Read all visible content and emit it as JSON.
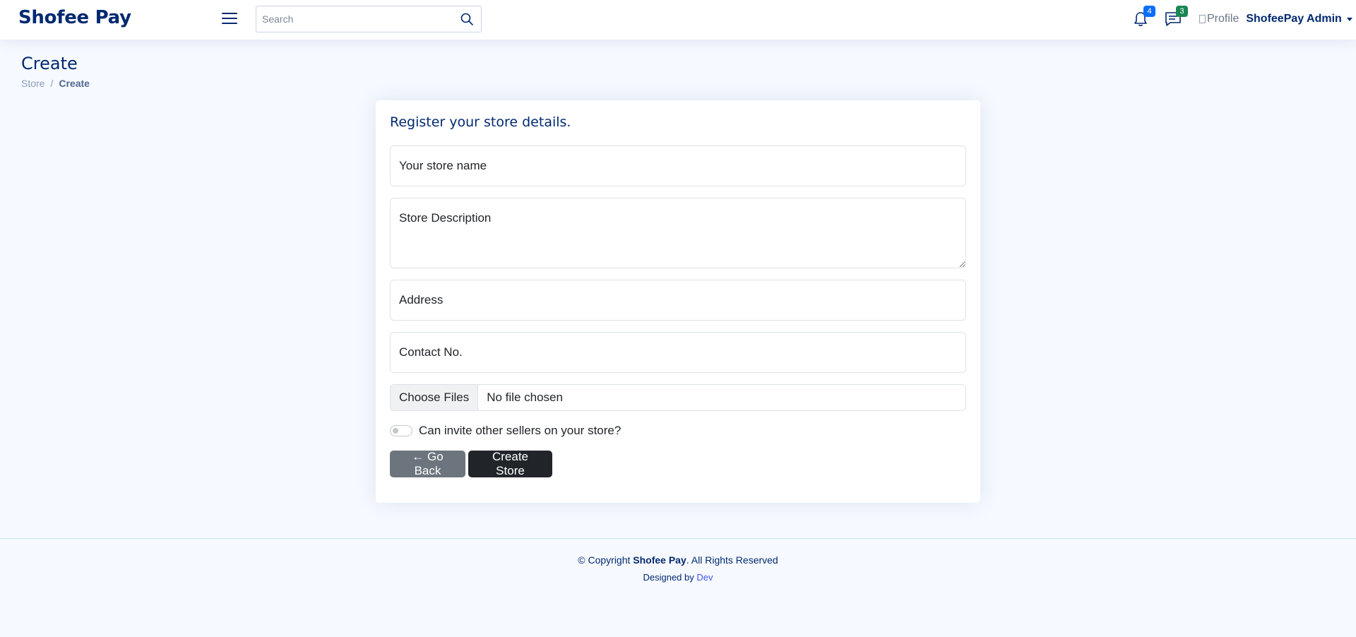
{
  "header": {
    "logo": "Shofee Pay",
    "search_placeholder": "Search",
    "notifications_count": "4",
    "messages_count": "3",
    "profile_img_alt": "Profile",
    "profile_name": "ShofeePay Admin",
    "colors": {
      "notif_badge": "#0d6efd",
      "msg_badge": "#198754"
    }
  },
  "page": {
    "title": "Create",
    "breadcrumb": [
      "Store",
      "Create"
    ]
  },
  "form": {
    "heading": "Register your store details.",
    "store_name_placeholder": "Your store name",
    "description_placeholder": "Store Description",
    "address_placeholder": "Address",
    "contact_placeholder": "Contact No.",
    "file_button": "Choose Files",
    "file_status": "No file chosen",
    "invite_label": "Can invite other sellers on your store?",
    "invite_enabled": false,
    "back_button": "← Go Back",
    "create_button": "Create Store"
  },
  "footer": {
    "copyright_prefix": "© Copyright ",
    "brand": "Shofee Pay",
    "copyright_suffix": ". All Rights Reserved",
    "designed_by": "Designed by ",
    "designer": "Dev"
  }
}
